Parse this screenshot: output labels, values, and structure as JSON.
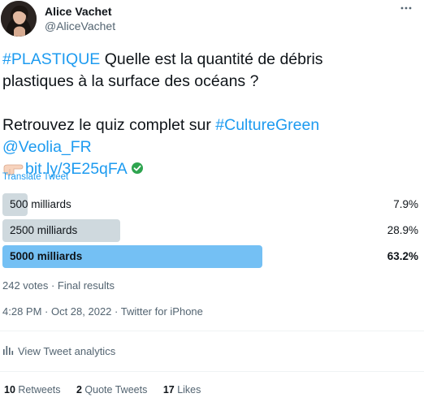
{
  "author": {
    "name": "Alice Vachet",
    "handle": "@AliceVachet"
  },
  "more_icon": "more-horizontal-icon",
  "tweet": {
    "line1_hashtag": "#PLASTIQUE",
    "line1_text": " Quelle est la quantité de débris",
    "line2": "plastiques à la surface des océans ?",
    "line3_text": "Retrouvez le quiz complet sur ",
    "line3_hashtag": "#CultureGreen",
    "line4_mention": "@Veolia_FR",
    "line5_link": "bit.ly/3E25qFA"
  },
  "translate_label": "Translate Tweet",
  "poll": {
    "options": [
      {
        "label": "500 milliards",
        "percent_label": "7.9%",
        "percent": 7.9,
        "winner": false
      },
      {
        "label": "2500 milliards",
        "percent_label": "28.9%",
        "percent": 28.9,
        "winner": false
      },
      {
        "label": "5000 milliards",
        "percent_label": "63.2%",
        "percent": 63.2,
        "winner": true
      }
    ],
    "meta": "242 votes · Final results"
  },
  "timestamp": "4:28 PM · Oct 28, 2022 · Twitter for iPhone",
  "analytics_label": "View Tweet analytics",
  "stats": {
    "retweets_count": "10",
    "retweets_label": "Retweets",
    "quotes_count": "2",
    "quotes_label": "Quote Tweets",
    "likes_count": "17",
    "likes_label": "Likes"
  },
  "colors": {
    "link": "#1d9bf0",
    "winner_bar": "#74c0f4",
    "bar": "#cfd9de",
    "secondary_text": "#536471"
  }
}
